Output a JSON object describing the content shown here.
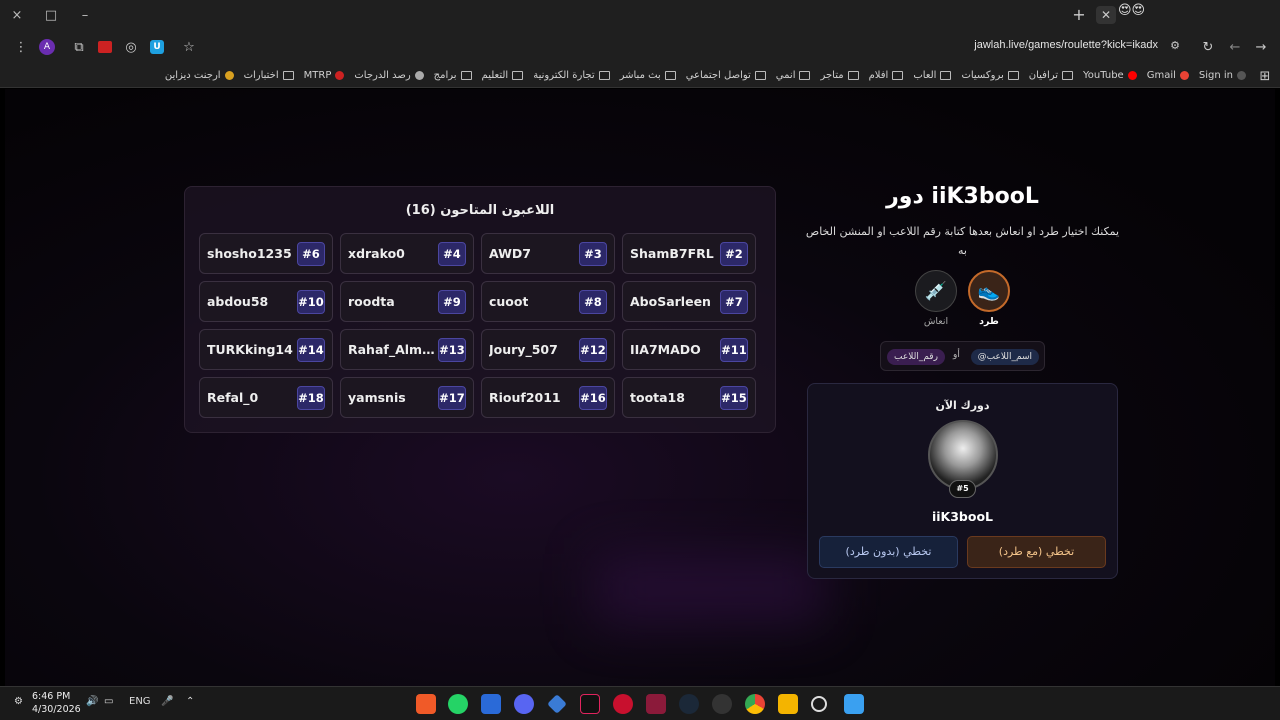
{
  "browser": {
    "url": "jawlah.live/games/roulette?kick=ikadx",
    "profile_initial": "A",
    "window_controls": [
      "×",
      "□",
      "–"
    ],
    "bookmarks": [
      {
        "label": "Sign in",
        "icon": "github-icon"
      },
      {
        "label": "Gmail",
        "icon": "gmail-icon"
      },
      {
        "label": "YouTube",
        "icon": "youtube-icon"
      },
      {
        "label": "ترافيان",
        "icon": "folder-icon"
      },
      {
        "label": "بروكسيات",
        "icon": "folder-icon"
      },
      {
        "label": "العاب",
        "icon": "folder-icon"
      },
      {
        "label": "افلام",
        "icon": "folder-icon"
      },
      {
        "label": "متاجر",
        "icon": "folder-icon"
      },
      {
        "label": "انمي",
        "icon": "folder-icon"
      },
      {
        "label": "تواصل اجتماعي",
        "icon": "folder-icon"
      },
      {
        "label": "بث مباشر",
        "icon": "folder-icon"
      },
      {
        "label": "تجارة الكترونية",
        "icon": "folder-icon"
      },
      {
        "label": "التعليم",
        "icon": "folder-icon"
      },
      {
        "label": "برامج",
        "icon": "folder-icon"
      },
      {
        "label": "رصد الدرجات",
        "icon": "globe-icon"
      },
      {
        "label": "MTRP",
        "icon": "mtrp-icon"
      },
      {
        "label": "اختبارات",
        "icon": "folder-icon"
      },
      {
        "label": "ارجنت ديزاين",
        "icon": "urgent-design-icon"
      }
    ]
  },
  "players_panel": {
    "title": "اللاعبون المتاحون (16)",
    "players": [
      {
        "name": "shosho1235",
        "num": "#6"
      },
      {
        "name": "xdrako0",
        "num": "#4"
      },
      {
        "name": "AWD7",
        "num": "#3"
      },
      {
        "name": "ShamB7FRL",
        "num": "#2"
      },
      {
        "name": "abdou58",
        "num": "#10"
      },
      {
        "name": "roodta",
        "num": "#9"
      },
      {
        "name": "cuoot",
        "num": "#8"
      },
      {
        "name": "AboSarleen",
        "num": "#7"
      },
      {
        "name": "TURKking14",
        "num": "#14"
      },
      {
        "name": "Rahaf_Almu...",
        "num": "#13"
      },
      {
        "name": "Joury_507",
        "num": "#12"
      },
      {
        "name": "IIA7MADO",
        "num": "#11"
      },
      {
        "name": "Refal_0",
        "num": "#18"
      },
      {
        "name": "yamsnis",
        "num": "#17"
      },
      {
        "name": "Riouf2011",
        "num": "#16"
      },
      {
        "name": "toota18",
        "num": "#15"
      }
    ]
  },
  "turn_panel": {
    "title": "دور iiK3booL",
    "help_text": "يمكنك اختيار طرد او انعاش بعدها كتابة رقم اللاعب او المنشن الخاص به",
    "kick_label": "طرد",
    "revive_label": "انعاش",
    "mention_hint": {
      "name_pill": "@اسم_اللاعب",
      "or": "أو",
      "number_pill": "رقم_اللاعب"
    },
    "current": {
      "title": "دورك الآن",
      "badge": "#5",
      "name": "iiK3booL",
      "skip_with_kick": "تخطي (مع طرد)",
      "skip_without_kick": "تخطي (بدون طرد)"
    }
  },
  "taskbar": {
    "time": "6:46 PM",
    "date": "4/30/2026",
    "language": "ENG"
  },
  "colors": {
    "accent_purple": "#2c2868",
    "kick_button": "#3a2418",
    "skip_button": "#16213a"
  }
}
